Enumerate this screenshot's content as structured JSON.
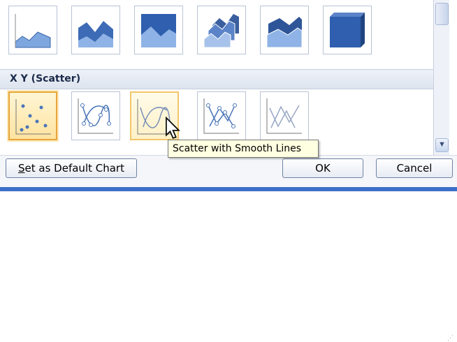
{
  "section": {
    "title": "X Y (Scatter)"
  },
  "tooltip": {
    "text": "Scatter with Smooth Lines"
  },
  "buttons": {
    "set_default": {
      "label": "Set as Default Chart",
      "mnemonic": "S",
      "rest": "et as Default Chart"
    },
    "ok": {
      "label": "OK"
    },
    "cancel": {
      "label": "Cancel"
    }
  },
  "area_charts": [
    "area-icon",
    "stacked-area-icon",
    "100-stacked-area-icon",
    "3d-area-icon",
    "3d-stacked-area-icon",
    "3d-100-stacked-area-icon"
  ],
  "scatter_charts": [
    "scatter-markers-icon",
    "scatter-smooth-lines-markers-icon",
    "scatter-smooth-lines-icon",
    "scatter-straight-lines-markers-icon",
    "scatter-straight-lines-icon"
  ],
  "selected_chart": "scatter-markers-icon",
  "hovered_chart": "scatter-smooth-lines-icon",
  "colors": {
    "accent": "#4a75b8",
    "selection": "#e7a53a",
    "tooltip_bg": "#ffffe1"
  }
}
